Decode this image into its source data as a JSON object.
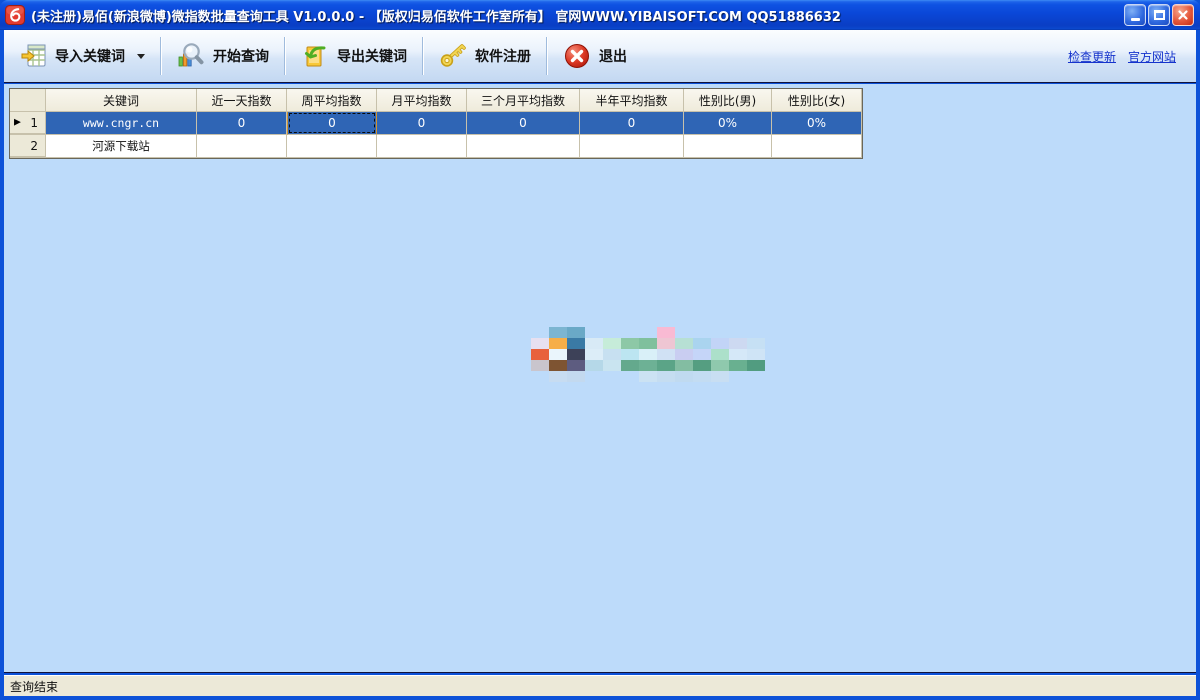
{
  "window": {
    "title": "(未注册)易佰(新浪微博)微指数批量查询工具 V1.0.0.0 -  【版权归易佰软件工作室所有】 官网WWW.YIBAISOFT.COM QQ51886632"
  },
  "toolbar": {
    "buttons": [
      {
        "label": "导入关键词",
        "icon": "import-keywords-icon",
        "has_dropdown": true
      },
      {
        "label": "开始查询",
        "icon": "start-query-icon"
      },
      {
        "label": "导出关键词",
        "icon": "export-keywords-icon"
      },
      {
        "label": "软件注册",
        "icon": "register-key-icon"
      },
      {
        "label": "退出",
        "icon": "exit-icon"
      }
    ],
    "links": [
      {
        "label": "检查更新"
      },
      {
        "label": "官方网站"
      }
    ]
  },
  "table": {
    "columns": [
      "关键词",
      "近一天指数",
      "周平均指数",
      "月平均指数",
      "三个月平均指数",
      "半年平均指数",
      "性别比(男)",
      "性别比(女)"
    ],
    "rows": [
      {
        "num": "1",
        "selected": true,
        "current": true,
        "cells": [
          "www.cngr.cn",
          "0",
          "0",
          "0",
          "0",
          "0",
          "0%",
          "0%"
        ]
      },
      {
        "num": "2",
        "selected": false,
        "current": false,
        "cells": [
          "河源下载站",
          "",
          "",
          "",
          "",
          "",
          "",
          ""
        ]
      }
    ],
    "focused_cell": {
      "row": 0,
      "col": 2
    }
  },
  "status_bar": {
    "text": "查询结束"
  },
  "watermark": {
    "rows": [
      [
        null,
        "#7cb5d1",
        "#6aa9c7",
        null,
        null,
        null,
        null,
        "#f9bad3",
        null,
        null,
        null,
        null,
        null
      ],
      [
        "#e7e0f0",
        "#f6ae48",
        "#3a7aa5",
        "#d8eaf6",
        "#c6ecd9",
        "#8dc8a6",
        "#7fc09d",
        "#eec6d3",
        "#b7e0d4",
        "#aad4ef",
        "#c2d4f7",
        "#cdd9f1",
        "#c6e0f4"
      ],
      [
        "#e8613c",
        "#eaf5fc",
        "#3d4158",
        "#dcedf8",
        "#c7e0f1",
        "#bce5f1",
        "#d9f0f8",
        "#d0e1f4",
        "#c9cdf1",
        "#c5d5f8",
        "#ace0ca",
        "#d5e8f8",
        "#cfe4f6"
      ],
      [
        "#c9c5cd",
        "#7e5432",
        "#5d5c80",
        "#b5d8e8",
        "#c9e4f0",
        "#64a98d",
        "#6db195",
        "#5ba487",
        "#83bda2",
        "#559e81",
        "#8fc9ad",
        "#69b090",
        "#519c80"
      ],
      [
        null,
        "#c7dcf1",
        "#c3d9ef",
        null,
        null,
        null,
        "#cbe2f3",
        "#c5ddf1",
        "#c0daf0",
        "#c3dcf2",
        "#c8def2",
        null,
        null
      ]
    ]
  },
  "colors": {
    "titlebar_blue": "#0A47D8",
    "window_border_blue": "#0D52D8",
    "selection_blue": "#2F65B5",
    "content_bg": "#BDDBFA",
    "statusbar_bg": "#ECE9D8",
    "link_blue": "#1533CC",
    "grid_line_tan": "#C7C1AB",
    "close_button_red": "#C52B11"
  }
}
